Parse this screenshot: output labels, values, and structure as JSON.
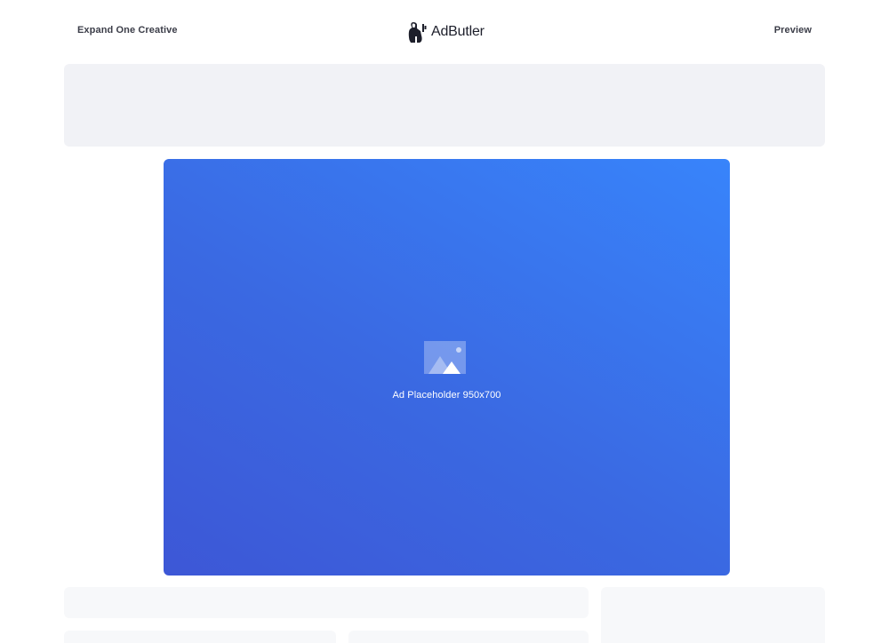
{
  "header": {
    "title": "Expand One Creative",
    "brand_name": "AdButler",
    "brand_logo_icon": "adbutler-logo-icon",
    "preview_label": "Preview"
  },
  "ad": {
    "label": "Ad Placeholder 950x700",
    "icon": "image-placeholder-icon",
    "gradient_start": "#3d57d6",
    "gradient_end": "#3884fb"
  },
  "colors": {
    "banner_bg": "#f1f2f6",
    "card_bg": "#f7f8fa",
    "text": "#3b3d48"
  }
}
